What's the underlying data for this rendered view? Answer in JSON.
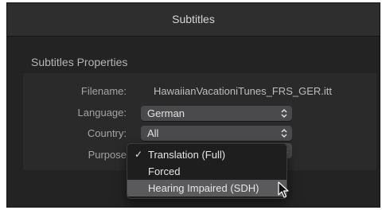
{
  "window": {
    "title": "Subtitles"
  },
  "section": {
    "title": "Subtitles Properties"
  },
  "fields": {
    "filename": {
      "label": "Filename:",
      "value": "HawaiianVacationiTunes_FRS_GER.itt"
    },
    "language": {
      "label": "Language:",
      "selected": "German"
    },
    "country": {
      "label": "Country:",
      "selected": "All"
    },
    "purpose": {
      "label": "Purpose"
    }
  },
  "purpose_menu": {
    "items": [
      {
        "label": "Translation (Full)",
        "checked": true
      },
      {
        "label": "Forced",
        "checked": false
      },
      {
        "label": "Hearing Impaired (SDH)",
        "checked": false,
        "highlighted": true
      }
    ],
    "check_glyph": "✓"
  },
  "icons": {
    "stepper": "updown-chevron-icon",
    "cursor": "pointer-cursor-icon"
  },
  "colors": {
    "window_bg": "#232324",
    "panel_bg": "#2a2a2b",
    "popup_bg": "#4a4a4c",
    "menu_highlight": "#5a5a5d"
  }
}
